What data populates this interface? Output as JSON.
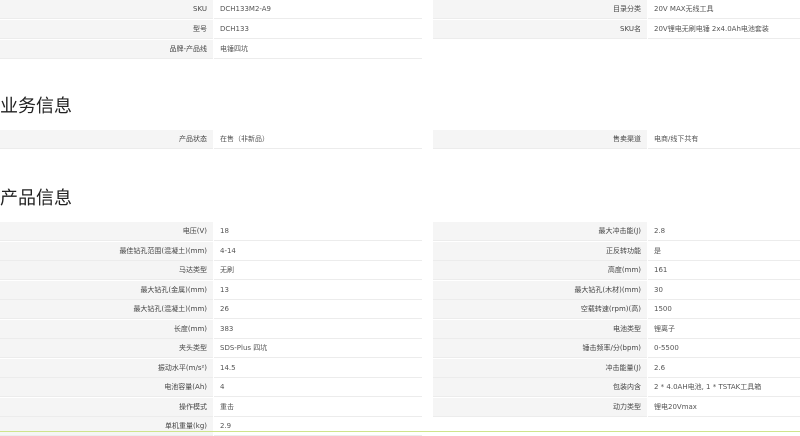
{
  "top": {
    "left_rows": [
      {
        "label": "SKU",
        "value": "DCH133M2-A9"
      },
      {
        "label": "型号",
        "value": "DCH133"
      },
      {
        "label": "品牌-产品线",
        "value": "电锤四坑"
      }
    ],
    "right_rows": [
      {
        "label": "目录分类",
        "value": "20V MAX无线工具"
      },
      {
        "label": "SKU名",
        "value": "20V锂电无刷电锤 2x4.0Ah电池套装"
      }
    ]
  },
  "business": {
    "title": "业务信息",
    "left_rows": [
      {
        "label": "产品状态",
        "value": "在售（非新品）"
      }
    ],
    "right_rows": [
      {
        "label": "售卖渠道",
        "value": "电商/线下共有"
      }
    ]
  },
  "product": {
    "title": "产品信息",
    "left_rows": [
      {
        "label": "电压(V)",
        "value": "18"
      },
      {
        "label": "最佳钻孔范围(混凝土)(mm)",
        "value": "4-14"
      },
      {
        "label": "马达类型",
        "value": "无刷"
      },
      {
        "label": "最大钻孔(金属)(mm)",
        "value": "13"
      },
      {
        "label": "最大钻孔(混凝土)(mm)",
        "value": "26"
      },
      {
        "label": "长度(mm)",
        "value": "383"
      },
      {
        "label": "夹头类型",
        "value": "SDS-Plus 四坑"
      },
      {
        "label": "振动水平(m/s²)",
        "value": "14.5"
      },
      {
        "label": "电池容量(Ah)",
        "value": "4"
      },
      {
        "label": "操作模式",
        "value": "重击"
      },
      {
        "label": "单机重量(kg)",
        "value": "2.9"
      }
    ],
    "right_rows": [
      {
        "label": "最大冲击能(J)",
        "value": "2.8"
      },
      {
        "label": "正反转功能",
        "value": "是"
      },
      {
        "label": "高度(mm)",
        "value": "161"
      },
      {
        "label": "最大钻孔(木材)(mm)",
        "value": "30"
      },
      {
        "label": "空载转速(rpm)(高)",
        "value": "1500"
      },
      {
        "label": "电池类型",
        "value": "锂离子"
      },
      {
        "label": "锤击频率/分(bpm)",
        "value": "0-5500"
      },
      {
        "label": "冲击能量(J)",
        "value": "2.6"
      },
      {
        "label": "包装内含",
        "value": "2 * 4.0AH电池, 1 * TSTAK工具箱"
      },
      {
        "label": "动力类型",
        "value": "锂电20Vmax"
      }
    ]
  }
}
